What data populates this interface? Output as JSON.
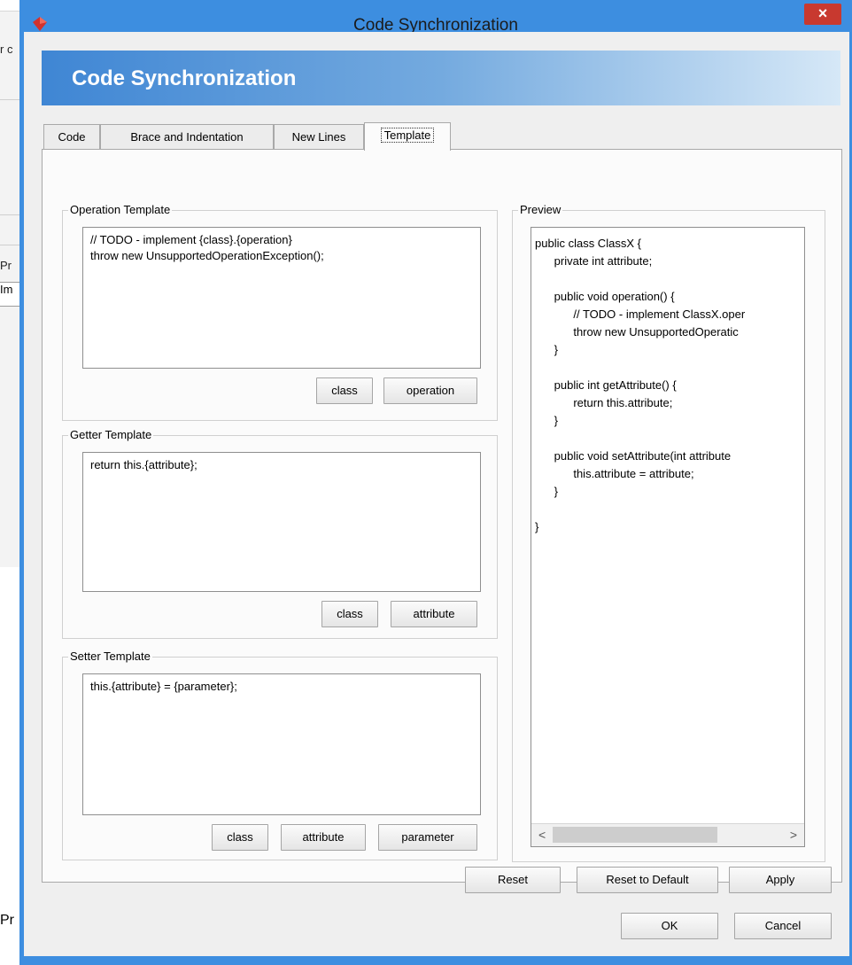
{
  "background": {
    "fragment_1": "r c",
    "fragment_2": "Pr",
    "fragment_3": "Im",
    "fragment_4": "Pr"
  },
  "dialog": {
    "title": "Code Synchronization",
    "close_label": "×",
    "banner_title": "Code Synchronization",
    "tabs": [
      {
        "label": "Code"
      },
      {
        "label": "Brace and Indentation"
      },
      {
        "label": "New Lines"
      },
      {
        "label": "Template"
      }
    ],
    "operation_template": {
      "label": "Operation Template",
      "value": "// TODO - implement {class}.{operation}\nthrow new UnsupportedOperationException();",
      "buttons": [
        "class",
        "operation"
      ]
    },
    "getter_template": {
      "label": "Getter Template",
      "value": "return this.{attribute};",
      "buttons": [
        "class",
        "attribute"
      ]
    },
    "setter_template": {
      "label": "Setter Template",
      "value": "this.{attribute} = {parameter};",
      "buttons": [
        "class",
        "attribute",
        "parameter"
      ]
    },
    "preview": {
      "label": "Preview",
      "code": "public class ClassX {\n      private int attribute;\n\n      public void operation() {\n            // TODO - implement ClassX.oper\n            throw new UnsupportedOperatic\n      }\n\n      public int getAttribute() {\n            return this.attribute;\n      }\n\n      public void setAttribute(int attribute\n            this.attribute = attribute;\n      }\n\n}",
      "scroll_left": "<",
      "scroll_right": ">"
    },
    "footer": {
      "reset": "Reset",
      "reset_default": "Reset to Default",
      "apply": "Apply",
      "ok": "OK",
      "cancel": "Cancel"
    }
  },
  "colors": {
    "title_bar": "#3d8ee0",
    "close_button": "#c8392f",
    "app_icon": "#d2322d"
  }
}
